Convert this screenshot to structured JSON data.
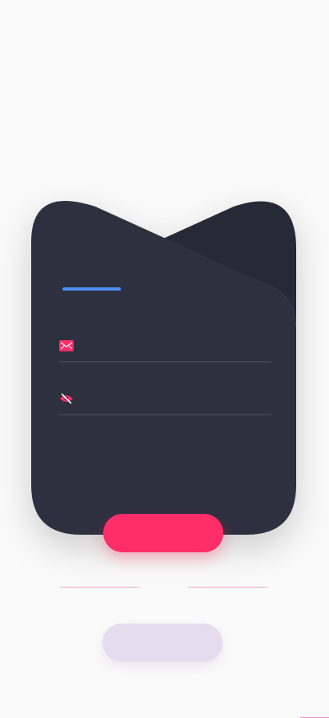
{
  "card": {
    "active_tab": "",
    "inactive_tab": ""
  },
  "form": {
    "email_value": "",
    "email_placeholder": "",
    "password_value": "",
    "password_placeholder": ""
  },
  "actions": {
    "submit_label": "",
    "divider_text": "",
    "secondary_label": "",
    "bottom_link": ""
  },
  "icons": {
    "email": "envelope-icon",
    "password": "eye-slash-icon"
  },
  "colors": {
    "background": "#fafafa",
    "card": "#2d303e",
    "card_back_tab": "#262936",
    "accent": "#ff2d68",
    "tab_indicator": "#4f8ef7",
    "secondary_button": "#e6dcee"
  }
}
